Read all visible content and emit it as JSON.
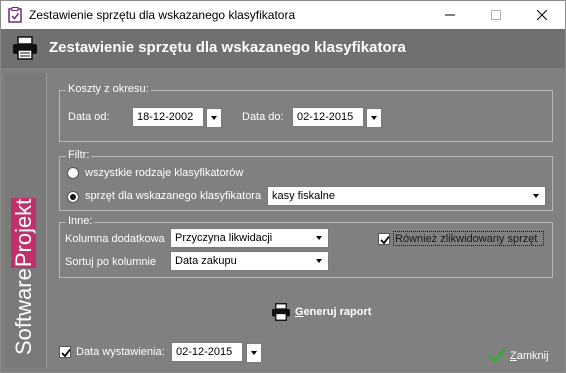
{
  "window": {
    "title": "Zestawienie sprzętu dla wskazanego klasyfikatora",
    "controls": [
      "minimize",
      "maximize",
      "close"
    ]
  },
  "header": {
    "title": "Zestawienie sprzętu dla wskazanego klasyfikatora",
    "icon": "printer-icon"
  },
  "sidebar": {
    "brand_a": "Software",
    "brand_b": "Projekt"
  },
  "costs": {
    "legend": "Koszty z okresu:",
    "from_label": "Data od:",
    "from_value": "18-12-2002",
    "to_label": "Data do:",
    "to_value": "02-12-2015"
  },
  "filter": {
    "legend": "Filtr:",
    "option_all": "wszystkie rodzaje klasyfikatorów",
    "option_selected": "sprzęt dla wskazanego klasyfikatora",
    "selected_option": "option_selected",
    "classifier_value": "kasy fiskalne"
  },
  "other": {
    "legend": "Inne:",
    "extra_column_label": "Kolumna dodatkowa",
    "extra_column_value": "Przyczyna likwidacji",
    "sort_label": "Sortuj po kolumnie",
    "sort_value": "Data zakupu",
    "include_liquidated_label": "Również zlikwidowany sprzęt",
    "include_liquidated_checked": true
  },
  "actions": {
    "generate_u": "G",
    "generate_rest": "eneruj raport",
    "close_u": "Z",
    "close_rest": "amknij"
  },
  "issue_date": {
    "label": "Data wystawienia:",
    "checked": true,
    "value": "02-12-2015"
  },
  "colors": {
    "panel": "#808080",
    "header": "#707070",
    "brand_accent": "#c0306a",
    "close_check": "#3aa53a"
  }
}
